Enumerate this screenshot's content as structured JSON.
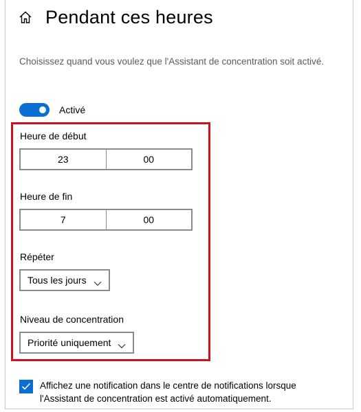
{
  "header": {
    "title": "Pendant ces heures",
    "home_icon": "home-icon"
  },
  "description": "Choisissez quand vous voulez que l'Assistant de concentration soit activé.",
  "toggle": {
    "state": "on",
    "label": "Activé",
    "accent_color": "#0a6fd0"
  },
  "start_time": {
    "label": "Heure de début",
    "hour": "23",
    "minute": "00"
  },
  "end_time": {
    "label": "Heure de fin",
    "hour": "7",
    "minute": "00"
  },
  "repeat": {
    "label": "Répéter",
    "value": "Tous les jours"
  },
  "focus_level": {
    "label": "Niveau de concentration",
    "value": "Priorité uniquement"
  },
  "notification": {
    "checked": true,
    "text": "Affichez une notification dans le centre de notifications lorsque l'Assistant de concentration est activé automatiquement."
  },
  "highlight_color": "#d0101b"
}
